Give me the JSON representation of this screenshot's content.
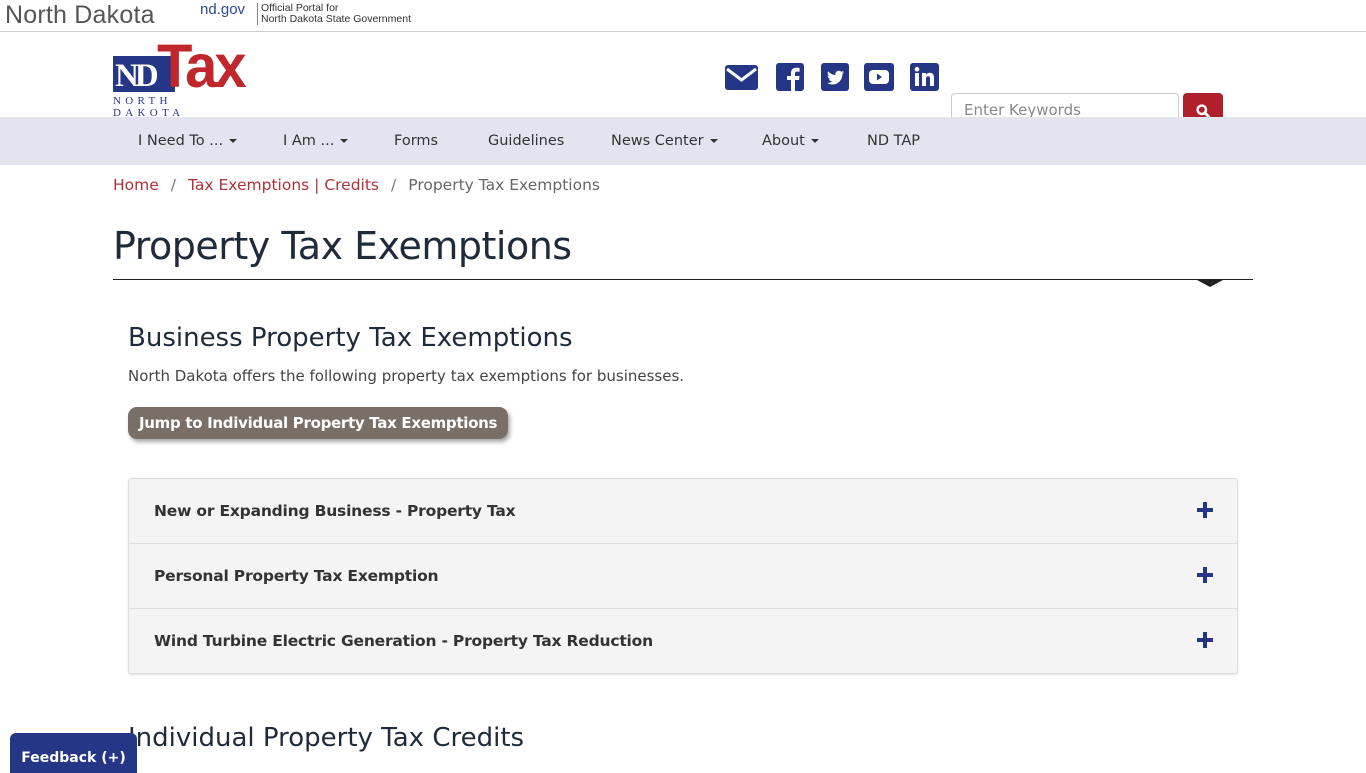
{
  "state_banner": {
    "state_name": "North Dakota",
    "ndgov": "nd.gov",
    "portal_line1": "Official Portal for",
    "portal_line2": "North Dakota State Government"
  },
  "logo": {
    "nd": "ND",
    "tax": "Tax",
    "sub": "NORTH DAKOTA"
  },
  "social_icons": [
    "email-icon",
    "facebook-icon",
    "twitter-icon",
    "youtube-icon",
    "linkedin-icon"
  ],
  "search": {
    "placeholder": "Enter Keywords",
    "value": "",
    "button_icon": "search-icon"
  },
  "nav": {
    "items": [
      {
        "label": "I Need To ...",
        "dropdown": true
      },
      {
        "label": "I Am ...",
        "dropdown": true
      },
      {
        "label": "Forms",
        "dropdown": false
      },
      {
        "label": "Guidelines",
        "dropdown": false
      },
      {
        "label": "News Center",
        "dropdown": true
      },
      {
        "label": "About",
        "dropdown": true
      },
      {
        "label": "ND TAP",
        "dropdown": false
      }
    ]
  },
  "breadcrumb": {
    "items": [
      "Home",
      "Tax Exemptions | Credits",
      "Property Tax Exemptions"
    ],
    "separator": "/"
  },
  "page_title": "Property Tax Exemptions",
  "business_section": {
    "title": "Business Property Tax Exemptions",
    "description": "North Dakota offers the following property tax exemptions for businesses.",
    "jump_button": "Jump to Individual Property Tax Exemptions",
    "accordion": [
      {
        "label": "New or Expanding Business - Property Tax",
        "icon": "plus-icon"
      },
      {
        "label": "Personal Property Tax Exemption",
        "icon": "plus-icon"
      },
      {
        "label": "Wind Turbine Electric Generation - Property Tax Reduction",
        "icon": "plus-icon"
      }
    ]
  },
  "individual_section": {
    "title": "Individual Property Tax Credits"
  },
  "feedback_button": "Feedback (+)",
  "colors": {
    "brand_blue": "#253687",
    "brand_red": "#c0272d",
    "nav_bg": "#e4e4f0",
    "jump_button_bg": "#7a6f66"
  }
}
